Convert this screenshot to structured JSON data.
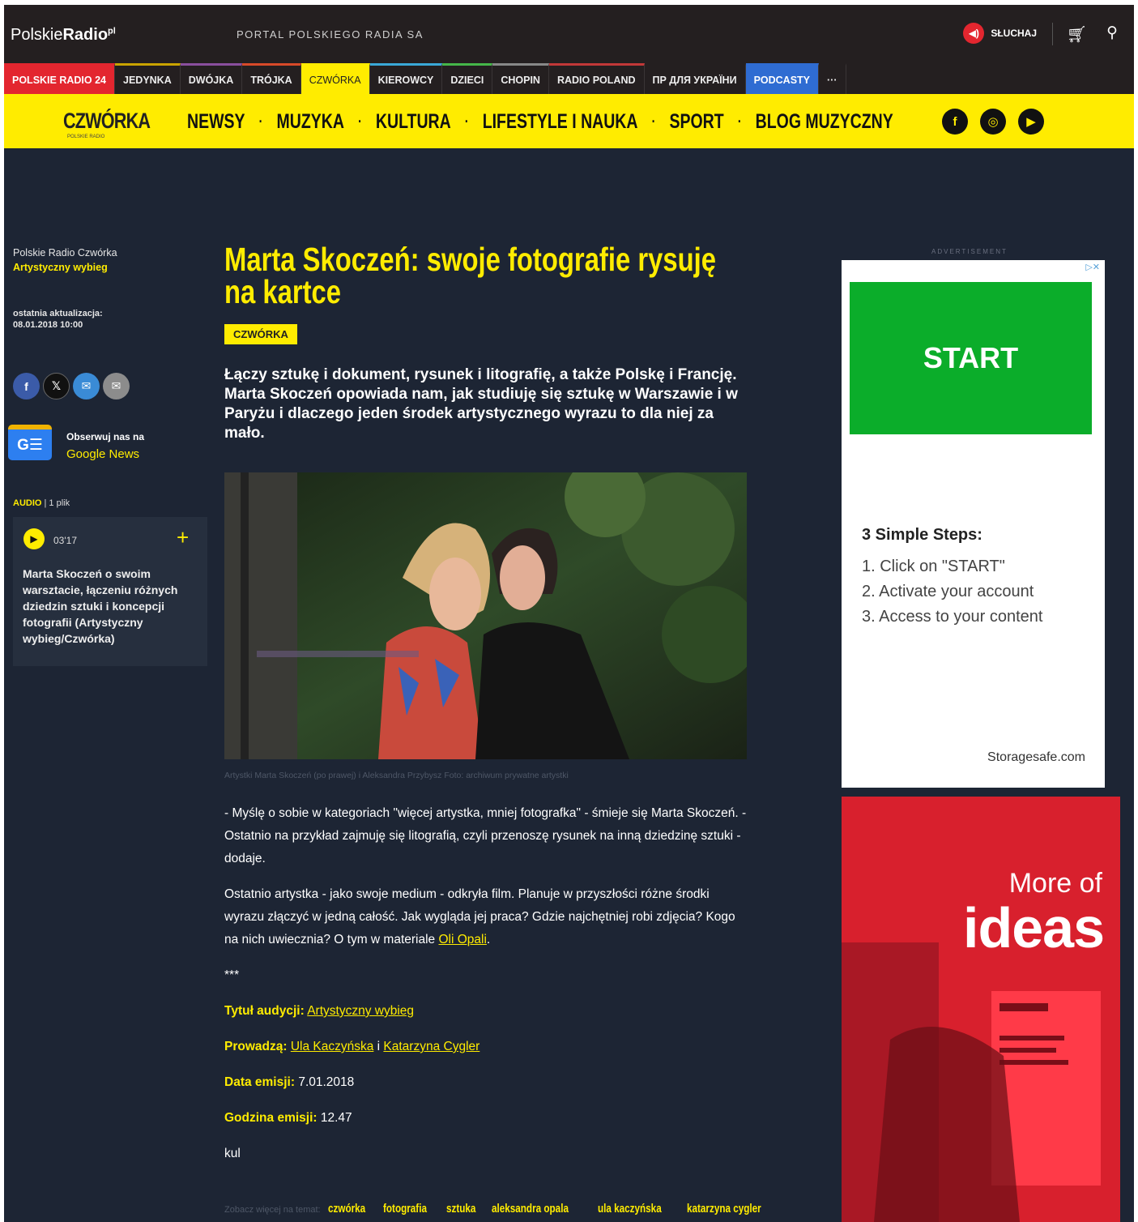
{
  "header": {
    "logo_a": "Polskie",
    "logo_b": "Radio",
    "logo_c": "pl",
    "portal": "PORTAL POLSKIEGO RADIA SA",
    "listen": "SŁUCHAJ"
  },
  "stations": [
    "POLSKIE RADIO 24",
    "JEDYNKA",
    "DWÓJKA",
    "TRÓJKA",
    "CZWÓRKA",
    "KIEROWCY",
    "DZIECI",
    "CHOPIN",
    "RADIO POLAND",
    "ПР ДЛЯ УКРАЇНИ",
    "PODCASTY",
    "···"
  ],
  "nav": {
    "brand": "CZWÓRKA",
    "brand_sub": "POLSKIE RADIO",
    "items": [
      "NEWSY",
      "MUZYKA",
      "KULTURA",
      "LIFESTYLE I NAUKA",
      "SPORT",
      "BLOG MUZYCZNY"
    ]
  },
  "sidebar": {
    "crumb": "Polskie Radio  Czwórka",
    "program": "Artystyczny wybieg",
    "update_label": "ostatnia aktualizacja:",
    "update_date": "08.01.2018 10:00",
    "gnews_1": "Obserwuj nas na",
    "gnews_2": "Google News",
    "audio_label": "AUDIO",
    "audio_count": "| 1 plik",
    "audio_duration": "03'17",
    "audio_title": "Marta Skoczeń o swoim warsztacie, łączeniu różnych dziedzin sztuki i koncepcji fotografii (Artystyczny wybieg/Czwórka)"
  },
  "article": {
    "title": "Marta Skoczeń: swoje fotografie rysuję na kartce",
    "tag": "CZWÓRKA",
    "lead": "Łączy sztukę i dokument, rysunek i litografię, a także Polskę i Francję. Marta Skoczeń opowiada nam, jak studiuję się sztukę w Warszawie i w Paryżu i dlaczego jeden środek artystycznego wyrazu to dla niej za mało.",
    "caption": "Artystki Marta Skoczeń (po prawej) i Aleksandra Przybysz  Foto: archiwum prywatne artystki",
    "p1": "- Myślę o sobie w kategoriach \"więcej artystka, mniej fotografka\" - śmieje się Marta Skoczeń. - Ostatnio na przykład zajmuję się litografią, czyli przenoszę rysunek na inną dziedzinę sztuki - dodaje.",
    "p2": "Ostatnio artystka - jako swoje medium - odkryła film. Planuje w przyszłości różne środki wyrazu złączyć w jedną całość. Jak wygląda jej praca? Gdzie najchętniej robi zdjęcia? Kogo na nich uwiecznia? O tym w materiale ",
    "p2_link": "Oli Opali",
    "stars": "***",
    "l1": "Tytuł audycji:",
    "v1": "Artystyczny wybieg",
    "l2": "Prowadzą:",
    "v2a": "Ula Kaczyńska",
    "v2b": "Katarzyna Cygler",
    "l3": "Data emisji:",
    "v3": "7.01.2018",
    "l4": "Godzina emisji:",
    "v4": "12.47",
    "foot": "kul",
    "seemore": "Zobacz więcej na temat:",
    "tags": [
      "czwórka",
      "fotografia",
      "sztuka",
      "aleksandra opala",
      "ula kaczyńska",
      "katarzyna cygler"
    ]
  },
  "ads": {
    "label": "ADVERTISEMENT",
    "start": "START",
    "steps_title": "3 Simple Steps:",
    "steps": [
      "1. Click on \"START\"",
      "2. Activate your account",
      "3. Access to your content"
    ],
    "domain": "Storagesafe.com",
    "more": "More of",
    "ideas": "ideas"
  },
  "colors": {
    "yellow": "#ffec00",
    "red": "#e3262f",
    "navy": "#1d2534",
    "topbar": "#241f20"
  }
}
